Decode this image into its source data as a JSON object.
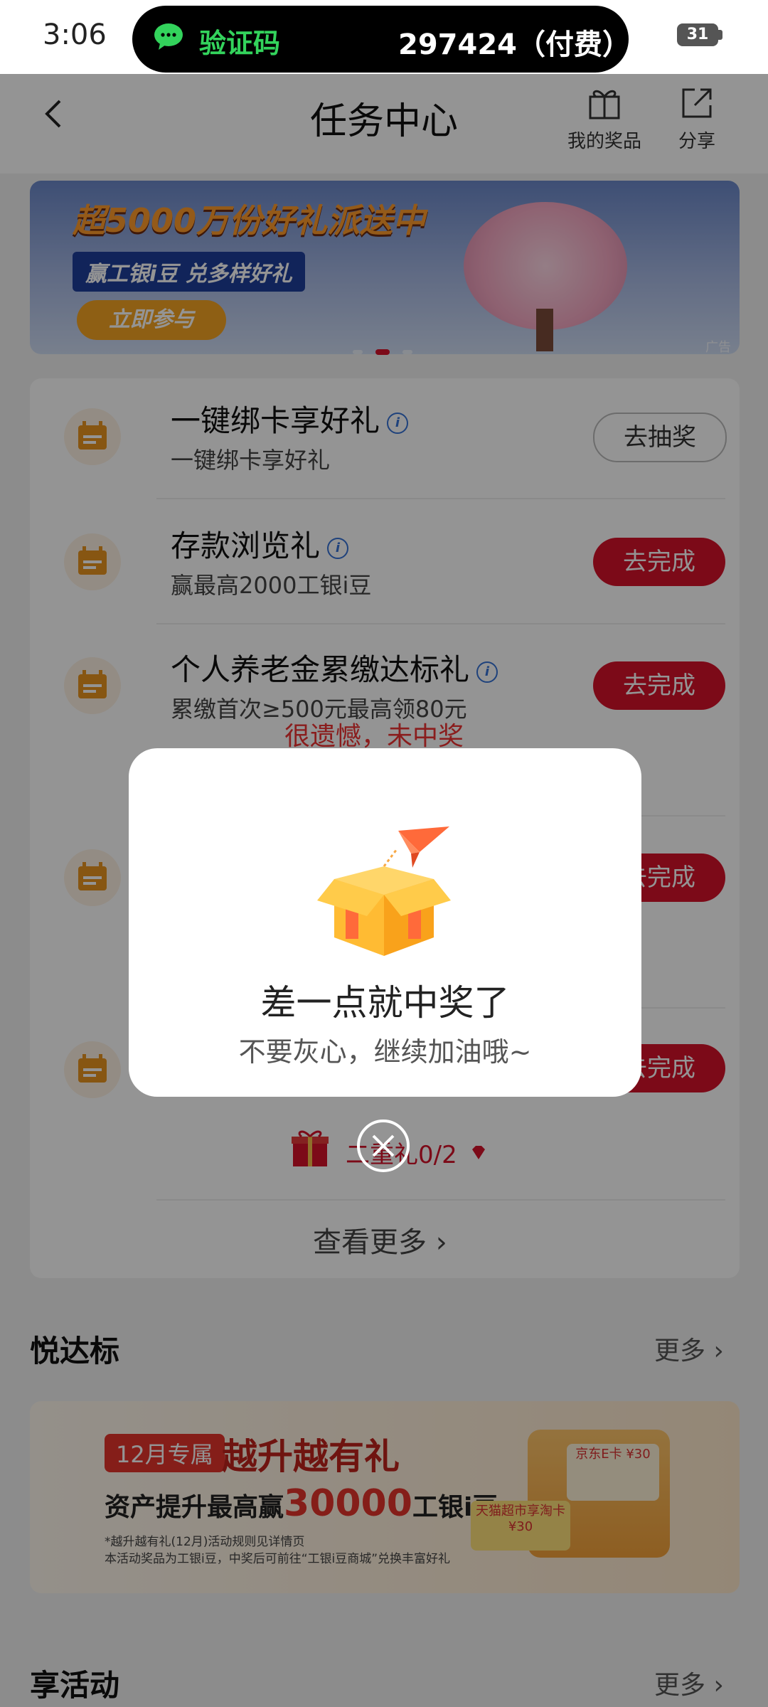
{
  "status_bar": {
    "time": "3:06",
    "notification": {
      "app": "验证码",
      "code": "297424（付费）",
      "icon": "wechat-icon"
    },
    "battery": "31"
  },
  "header": {
    "title": "任务中心",
    "back_icon": "chevron-left-icon",
    "prizes_label": "我的奖品",
    "share_label": "分享"
  },
  "banner": {
    "title": "超5000万份好礼派送中",
    "subtitle": "赢工银i豆 兑多样好礼",
    "cta": "立即参与",
    "ad_tag": "广告"
  },
  "tasks": [
    {
      "title": "一键绑卡享好礼",
      "desc": "一键绑卡享好礼",
      "button": "去抽奖",
      "style": "outline"
    },
    {
      "title": "存款浏览礼",
      "desc": "赢最高2000工银i豆",
      "button": "去完成",
      "style": "red"
    },
    {
      "title": "个人养老金累缴达标礼",
      "desc": "累缴首次≥500元最高领80元",
      "button": "去完成",
      "style": "red"
    },
    {
      "title": "",
      "desc": "",
      "button": "去完成",
      "style": "red"
    },
    {
      "title": "",
      "desc": "",
      "button": "去完成",
      "style": "red"
    }
  ],
  "card": {
    "red_note": "很遗憾，未中奖",
    "progress_label": "二重礼0/2",
    "more_link": "查看更多"
  },
  "section1": {
    "title": "悦达标",
    "more": "更多"
  },
  "banner2": {
    "tag": "12月专属",
    "title": "越升越有礼",
    "line_prefix": "资产提升最高赢",
    "line_big": "30000",
    "line_suffix": "工银i豆",
    "note1": "*越升越有礼(12月)活动规则见详情页",
    "note2": "本活动奖品为工银i豆，中奖后可前往“工银i豆商城”兑换丰富好礼",
    "ticket1": "天猫超市享淘卡 ¥30",
    "ticket2": "京东E卡 ¥30"
  },
  "section2": {
    "title": "享活动",
    "more": "更多"
  },
  "modal": {
    "title": "差一点就中奖了",
    "subtitle": "不要灰心，继续加油哦~",
    "illustration": "open-gift-box-icon",
    "close_icon": "close-icon"
  },
  "colors": {
    "accent_red": "#d6122a",
    "icon_orange": "#e8951f",
    "wechat_green": "#33d35c"
  }
}
